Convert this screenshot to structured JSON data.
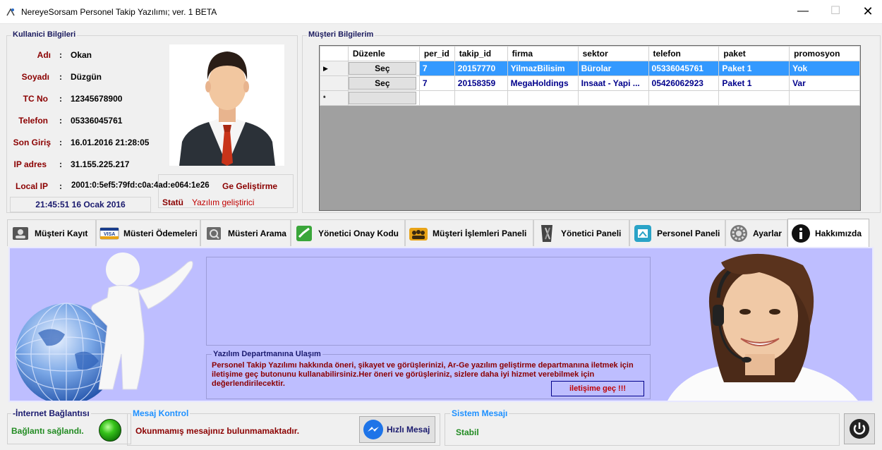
{
  "window": {
    "title": "NereyeSorsam Personel Takip Yazılımı; ver. 1 BETA",
    "minimize": "—",
    "maximize": "☐",
    "close": "✕"
  },
  "user_box": {
    "title": "Kullanici Bilgileri",
    "fields": [
      {
        "label": "Adı",
        "value": "Okan"
      },
      {
        "label": "Soyadı",
        "value": "Düzgün"
      },
      {
        "label": "TC No",
        "value": "12345678900"
      },
      {
        "label": "Telefon",
        "value": "05336045761"
      },
      {
        "label": "Son Giriş",
        "value": "16.01.2016 21:28:05"
      },
      {
        "label": "IP adres",
        "value": "31.155.225.217"
      },
      {
        "label": "Local IP",
        "value": "2001:0:5ef5:79fd:c0a:4ad:e064:1e26"
      }
    ],
    "role_overflow": "Ge Geliştirme",
    "status_label": "Statü",
    "status_value": "Yazılım geliştirici",
    "clock": "21:45:51 16 Ocak 2016"
  },
  "customers": {
    "title": "Müşteri Bilgilerim",
    "columns": [
      "Düzenle",
      "per_id",
      "takip_id",
      "firma",
      "sektor",
      "telefon",
      "paket",
      "promosyon"
    ],
    "button_label": "Seç",
    "new_row_marker": "*",
    "current_row_marker": "▶",
    "rows": [
      {
        "per_id": "7",
        "takip_id": "20157770",
        "firma": "YilmazBilisim",
        "sektor": "Bürolar",
        "telefon": "05336045761",
        "paket": "Paket 1",
        "promosyon": "Yok"
      },
      {
        "per_id": "7",
        "takip_id": "20158359",
        "firma": "MegaHoldings",
        "sektor": "Insaat - Yapi ...",
        "telefon": "05426062923",
        "paket": "Paket 1",
        "promosyon": "Var"
      }
    ]
  },
  "tabs": [
    {
      "label": "Müşteri Kayıt",
      "icon": "user-card-icon"
    },
    {
      "label": "Müsteri Ödemeleri",
      "icon": "visa-card-icon"
    },
    {
      "label": "Müsteri Arama",
      "icon": "search-folder-icon"
    },
    {
      "label": "Yönetici Onay Kodu",
      "icon": "approve-code-icon"
    },
    {
      "label": "Müşteri İşlemleri Paneli",
      "icon": "group-icon"
    },
    {
      "label": "Yönetici Paneli",
      "icon": "admin-icon"
    },
    {
      "label": "Personel Paneli",
      "icon": "staff-icon"
    },
    {
      "label": "Ayarlar",
      "icon": "settings-icon"
    },
    {
      "label": "Hakkımızda",
      "icon": "info-icon"
    }
  ],
  "about": {
    "contact_title": "Yazılım Departmanına Ulaşım",
    "contact_text": "Personel Takip Yazılımı hakkında öneri, şikayet ve görüşlerinizi, Ar-Ge yazılım geliştirme departmanına iletmek için iletişime geç butonunu kullanabilirsiniz.Her öneri ve görüşleriniz, sizlere daha iyi hizmet verebilmek için değerlendirilecektir.",
    "contact_button": "iletişime geç !!!"
  },
  "footer": {
    "net_title": "-İnternet Bağlantısı",
    "net_status": "Bağlantı sağlandı.",
    "msg_title": "Mesaj Kontrol",
    "msg_status": "Okunmamış mesajınız bulunmamaktadır.",
    "fast_msg_button": "Hızlı Mesaj",
    "sys_title": "Sistem Mesajı",
    "sys_status": "Stabil"
  },
  "colors": {
    "label_red": "#8b0000",
    "title_blue": "#1a1a6e",
    "selected_row": "#3399ff",
    "panel_lavender": "#bebeff",
    "ok_green": "#228b22"
  }
}
